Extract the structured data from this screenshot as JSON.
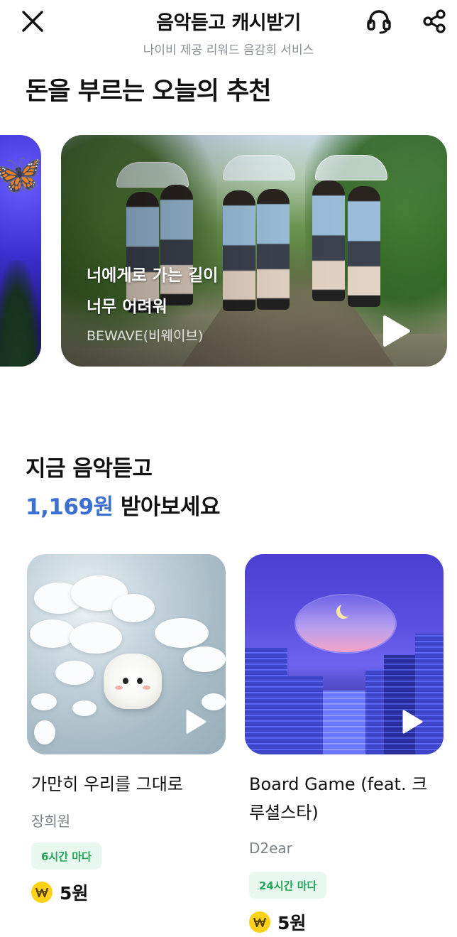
{
  "header": {
    "title": "음악듣고 캐시받기",
    "subtitle": "나이비 제공 리워드 음감회 서비스",
    "icons": {
      "close": "close-icon",
      "support": "headset-icon",
      "share": "share-icon"
    }
  },
  "recommend": {
    "title": "돈을 부르는 오늘의 추천",
    "banner": {
      "line1": "너에게로 가는 길이",
      "line2": "너무 어려워",
      "artist": "BEWAVE(비웨이브)"
    }
  },
  "cash": {
    "line1": "지금 음악듣고",
    "amount": "1,169원",
    "suffix": " 받아보세요",
    "accent_color": "#3b6fd4"
  },
  "cards": [
    {
      "title": "가만히 우리를 그대로",
      "artist": "장희원",
      "badge": "6시간 마다",
      "reward": "5원"
    },
    {
      "title": "Board Game (feat. 크루셜스타)",
      "title_line1": "Board Game (feat. 크",
      "title_line2": "루셜스타)",
      "artist": "D2ear",
      "badge": "24시간 마다",
      "reward": "5원"
    }
  ],
  "colors": {
    "badge_bg": "#e9f8ee",
    "badge_text": "#23a55a",
    "coin": "#ffd21a"
  }
}
